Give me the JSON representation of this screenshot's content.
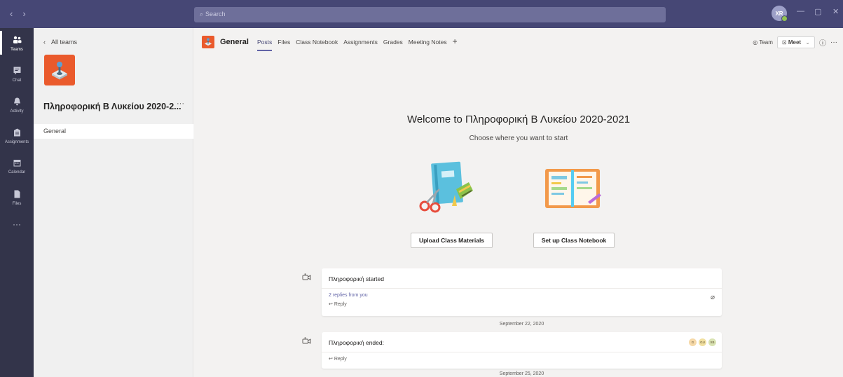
{
  "topbar": {
    "search_placeholder": "Search",
    "user_initials": "XR",
    "minimize": "—",
    "maximize": "▢",
    "close": "✕"
  },
  "rail": {
    "items": [
      {
        "label": "Teams",
        "icon": "teams-icon",
        "active": true
      },
      {
        "label": "Chat",
        "icon": "chat-icon"
      },
      {
        "label": "Activity",
        "icon": "bell-icon"
      },
      {
        "label": "Assignments",
        "icon": "assignments-icon"
      },
      {
        "label": "Calendar",
        "icon": "calendar-icon"
      },
      {
        "label": "Files",
        "icon": "files-icon"
      }
    ],
    "more": "···"
  },
  "teampanel": {
    "back_label": "All teams",
    "team_name": "Πληροφορική Β Λυκείου 2020-2...",
    "more": "···",
    "channels": [
      {
        "label": "General",
        "selected": true
      }
    ]
  },
  "header": {
    "channel": "General",
    "tabs": [
      "Posts",
      "Files",
      "Class Notebook",
      "Assignments",
      "Grades",
      "Meeting Notes"
    ],
    "active_tab": "Posts",
    "add": "+",
    "team_btn": "Team",
    "meet_btn": "Meet",
    "info": "ⓘ",
    "more": "···"
  },
  "welcome": {
    "title": "Welcome to Πληροφορική Β Λυκείου 2020-2021",
    "subtitle": "Choose where you want to start",
    "upload_btn": "Upload Class Materials",
    "notebook_btn": "Set up Class Notebook"
  },
  "posts": [
    {
      "title": "Πληροφορική started",
      "replies": "2 replies from you",
      "reply": "Reply"
    },
    {
      "title": "Πληροφορική ended:",
      "reply": "Reply",
      "avatars": [
        "G",
        "GU",
        "XB"
      ]
    }
  ],
  "dates": [
    "September 22, 2020",
    "September 25, 2020"
  ],
  "colors": {
    "topbar": "#464775",
    "rail": "#33344a",
    "brand_orange": "#ea5a2c",
    "accent": "#6264a7"
  }
}
